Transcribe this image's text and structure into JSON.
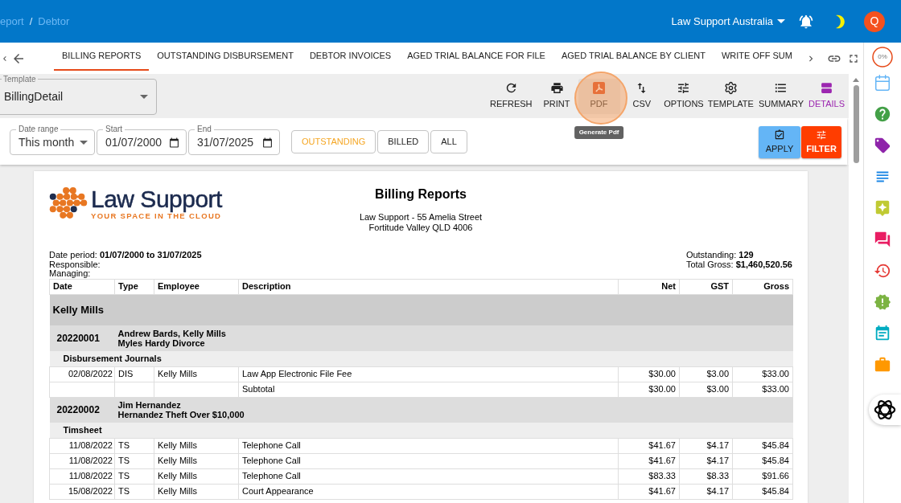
{
  "breadcrumb": {
    "items": [
      "eport",
      "Debtor"
    ],
    "separator": "/"
  },
  "account": {
    "org": "Law Support Australia",
    "avatar": "Q"
  },
  "tabs": [
    {
      "label": "BILLING REPORTS",
      "selected": true
    },
    {
      "label": "OUTSTANDING DISBURSEMENT",
      "selected": false
    },
    {
      "label": "DEBTOR INVOICES",
      "selected": false
    },
    {
      "label": "AGED TRIAL BALANCE FOR FILE",
      "selected": false
    },
    {
      "label": "AGED TRIAL BALANCE BY CLIENT",
      "selected": false
    },
    {
      "label": "WRITE OFF SUM",
      "selected": false
    }
  ],
  "template": {
    "label": "Template",
    "value": "BillingDetail"
  },
  "toolbar": [
    {
      "label": "REFRESH",
      "selected": false,
      "highlighted": false
    },
    {
      "label": "PRINT",
      "selected": false,
      "highlighted": false
    },
    {
      "label": "PDF",
      "selected": false,
      "highlighted": true
    },
    {
      "label": "CSV",
      "selected": false,
      "highlighted": false
    },
    {
      "label": "OPTIONS",
      "selected": false,
      "highlighted": false
    },
    {
      "label": "TEMPLATE",
      "selected": false,
      "highlighted": false
    },
    {
      "label": "SUMMARY",
      "selected": false,
      "highlighted": false
    },
    {
      "label": "DETAILS",
      "selected": true,
      "highlighted": false
    }
  ],
  "tooltip": "Generate Pdf",
  "filters": {
    "date_range": {
      "label": "Date range",
      "value": "This month"
    },
    "start": {
      "label": "Start",
      "value": "01/07/2000"
    },
    "end": {
      "label": "End",
      "value": "31/07/2025"
    }
  },
  "status_filters": [
    {
      "label": "OUTSTANDING",
      "selected": true
    },
    {
      "label": "BILLED",
      "selected": false
    },
    {
      "label": "ALL",
      "selected": false
    }
  ],
  "apply_button": "APPLY",
  "filter_button": "FILTER",
  "report": {
    "logo": {
      "name": "Law Support",
      "tagline": "YOUR SPACE IN THE CLOUD"
    },
    "title": "Billing Reports",
    "address": [
      "Law Support - 55 Amelia Street",
      "Fortitude Valley QLD 4006"
    ],
    "meta_left": [
      "Date period: **01/07/2000 to 31/07/2025**",
      "Responsible:",
      "Managing:"
    ],
    "meta_right": [
      "Outstanding: **129**",
      "Total Gross: **$1,460,520.56**"
    ],
    "table": {
      "columns": [
        "Date",
        "Type",
        "Employee",
        "Description",
        "Net",
        "GST",
        "Gross"
      ],
      "groups": [
        {
          "name": "Kelly Mills",
          "matters": [
            {
              "number": "20220001",
              "client": "Andrew Bards, Kelly Mills",
              "title": "Myles Hardy Divorce",
              "sections": [
                {
                  "name": "Disbursement Journals",
                  "rows": [
                    {
                      "kind": "entry",
                      "date": "02/08/2022",
                      "type": "DIS",
                      "employee": "Kelly Mills",
                      "description": "Law App Electronic File Fee",
                      "net": "$30.00",
                      "gst": "$3.00",
                      "gross": "$33.00"
                    },
                    {
                      "kind": "subtotal",
                      "label": "Subtotal",
                      "net": "$30.00",
                      "gst": "$3.00",
                      "gross": "$33.00"
                    }
                  ]
                }
              ]
            },
            {
              "number": "20220002",
              "client": "Jim Hernandez",
              "title": "Hernandez Theft Over $10,000",
              "sections": [
                {
                  "name": "Timsheet",
                  "rows": [
                    {
                      "kind": "entry",
                      "date": "11/08/2022",
                      "type": "TS",
                      "employee": "Kelly Mills",
                      "description": "Telephone Call",
                      "net": "$41.67",
                      "gst": "$4.17",
                      "gross": "$45.84"
                    },
                    {
                      "kind": "entry",
                      "date": "11/08/2022",
                      "type": "TS",
                      "employee": "Kelly Mills",
                      "description": "Telephone Call",
                      "net": "$41.67",
                      "gst": "$4.17",
                      "gross": "$45.84"
                    },
                    {
                      "kind": "entry",
                      "date": "11/08/2022",
                      "type": "TS",
                      "employee": "Kelly Mills",
                      "description": "Telephone Call",
                      "net": "$83.33",
                      "gst": "$8.33",
                      "gross": "$91.66"
                    },
                    {
                      "kind": "entry",
                      "date": "15/08/2022",
                      "type": "TS",
                      "employee": "Kelly Mills",
                      "description": "Court Appearance",
                      "net": "$41.67",
                      "gst": "$4.17",
                      "gross": "$45.84"
                    }
                  ]
                }
              ]
            }
          ]
        }
      ]
    }
  },
  "sidebar": {
    "progress_label": "0%"
  }
}
